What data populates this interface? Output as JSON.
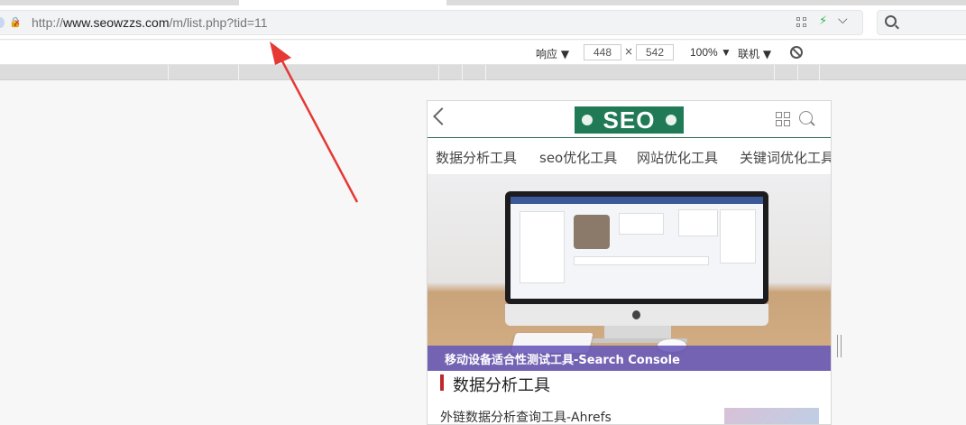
{
  "browser": {
    "url_scheme": "http://",
    "url_host": "www.seowzzs.com",
    "url_path": "/m/list.php?tid=11"
  },
  "responsive": {
    "mode_label": "响应 ▼",
    "width": "448",
    "height": "542",
    "times": "×",
    "zoom_label": "100% ▼",
    "network_label": "联机 ▼"
  },
  "mobile": {
    "logo_text": "SEO",
    "nav": [
      "数据分析工具",
      "seo优化工具",
      "网站优化工具",
      "关键词优化工具"
    ],
    "banner_caption": "移动设备适合性测试工具-Search Console",
    "section_title": "数据分析工具",
    "first_item_partial": "外链数据分析查询工具-Ahrefs"
  },
  "colors": {
    "logo_bg": "#1f7a55",
    "caption_bg": "#6658ba",
    "section_accent": "#c0282c",
    "annotation_arrow": "#e53935"
  },
  "icons": {
    "back": "chevron-left-icon",
    "grid": "grid-icon",
    "search": "search-icon",
    "rotate": "rotate-icon",
    "bolt": "lightning-icon"
  }
}
